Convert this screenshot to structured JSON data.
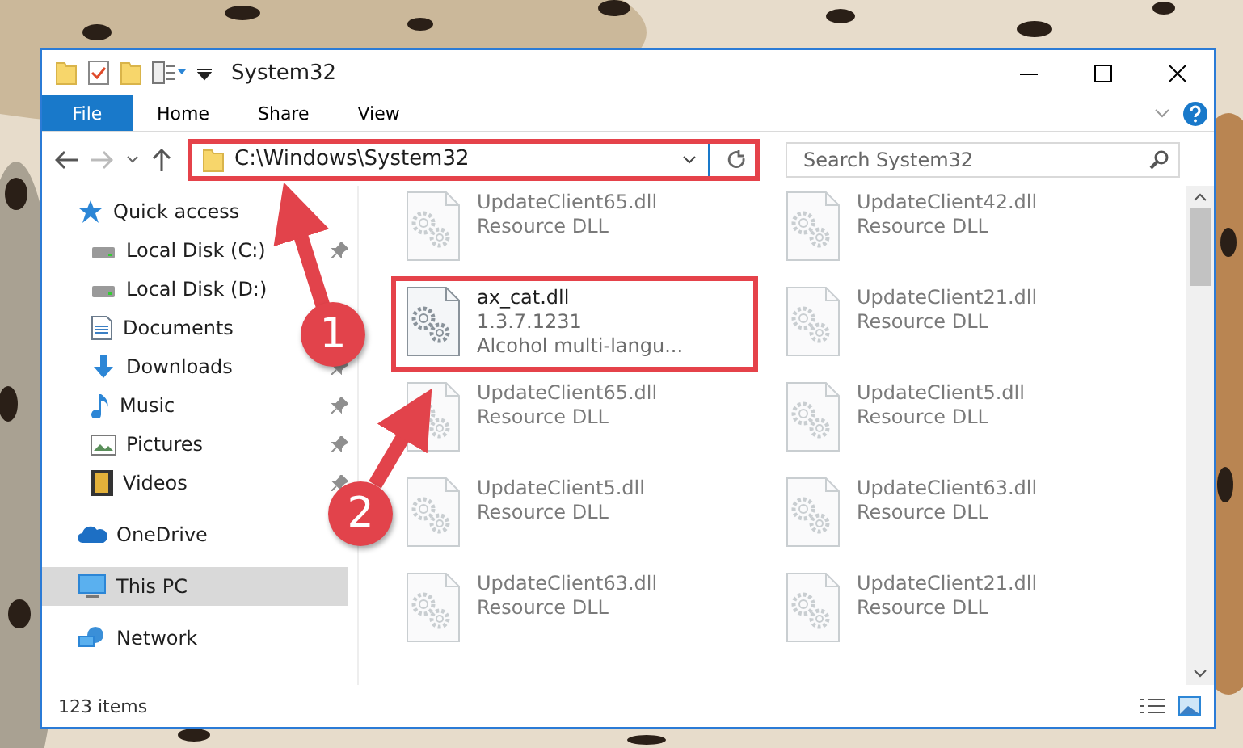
{
  "window": {
    "title": "System32",
    "file_tab": "File",
    "ribbon_tabs": [
      {
        "label": "Home",
        "selected": false
      },
      {
        "label": "Share",
        "selected": false
      },
      {
        "label": "View",
        "selected": false
      }
    ]
  },
  "address": {
    "path": "C:\\Windows\\System32",
    "search_placeholder": "Search System32",
    "highlighted": true
  },
  "sidebar": [
    {
      "label": "Quick access",
      "kind": "star",
      "selected": false,
      "children": [
        {
          "label": "Local Disk (C:)",
          "kind": "drive",
          "pinned": true,
          "selected": false
        },
        {
          "label": "Local Disk (D:)",
          "kind": "drive",
          "selected": false
        },
        {
          "label": "Documents",
          "kind": "doc",
          "selected": false
        },
        {
          "label": "Downloads",
          "kind": "download",
          "pinned": true,
          "selected": false
        },
        {
          "label": "Music",
          "kind": "music",
          "pinned": true,
          "selected": false
        },
        {
          "label": "Pictures",
          "kind": "pictures",
          "pinned": true,
          "selected": false
        },
        {
          "label": "Videos",
          "kind": "video",
          "pinned": true,
          "selected": false
        }
      ]
    },
    {
      "label": "OneDrive",
      "kind": "cloud",
      "selected": false
    },
    {
      "label": "This PC",
      "kind": "pc",
      "selected": true
    },
    {
      "label": "Network",
      "kind": "network",
      "selected": false
    }
  ],
  "files": [
    {
      "name": "UpdateClient65.dll",
      "lines": [
        "Resource DLL"
      ],
      "blurred": true,
      "highlighted": false
    },
    {
      "name": "UpdateClient42.dll",
      "lines": [
        "Resource DLL"
      ],
      "blurred": true,
      "highlighted": false
    },
    {
      "name": "ax_cat.dll",
      "lines": [
        "1.3.7.1231",
        "Alcohol multi-langu..."
      ],
      "blurred": false,
      "highlighted": true
    },
    {
      "name": "UpdateClient21.dll",
      "lines": [
        "Resource DLL"
      ],
      "blurred": true,
      "highlighted": false
    },
    {
      "name": "UpdateClient65.dll",
      "lines": [
        "Resource DLL"
      ],
      "blurred": true,
      "highlighted": false
    },
    {
      "name": "UpdateClient5.dll",
      "lines": [
        "Resource DLL"
      ],
      "blurred": true,
      "highlighted": false
    },
    {
      "name": "UpdateClient5.dll",
      "lines": [
        "Resource DLL"
      ],
      "blurred": true,
      "highlighted": false
    },
    {
      "name": "UpdateClient63.dll",
      "lines": [
        "Resource DLL"
      ],
      "blurred": true,
      "highlighted": false
    },
    {
      "name": "UpdateClient63.dll",
      "lines": [
        "Resource DLL"
      ],
      "blurred": true,
      "highlighted": false
    },
    {
      "name": "UpdateClient21.dll",
      "lines": [
        "Resource DLL"
      ],
      "blurred": true,
      "highlighted": false
    }
  ],
  "status_bar": "123 items",
  "annotations": [
    {
      "number": "1"
    },
    {
      "number": "2"
    }
  ]
}
